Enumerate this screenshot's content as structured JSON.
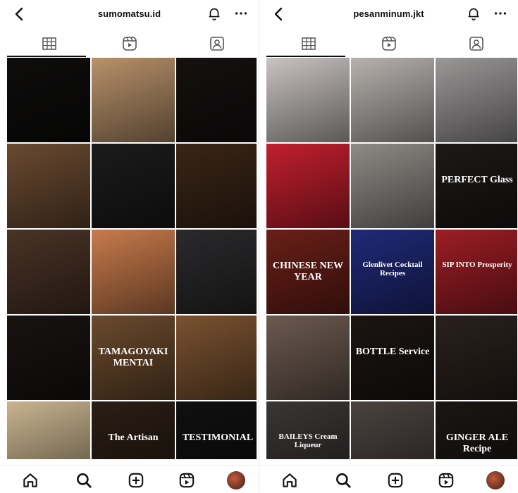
{
  "left": {
    "username": "sumomatsu.id",
    "tiles": [
      {
        "bg": "#0e0d0c"
      },
      {
        "bg": "#b8916a"
      },
      {
        "bg": "#141110"
      },
      {
        "bg": "#6a4a31"
      },
      {
        "bg": "#1b1b1b"
      },
      {
        "bg": "#3a2516"
      },
      {
        "bg": "#4a3326"
      },
      {
        "bg": "#c87b4c"
      },
      {
        "bg": "#2a2a2c"
      },
      {
        "bg": "#171311"
      },
      {
        "bg": "#6b4a2d",
        "caption": "TAMAGOYAKI MENTAI"
      },
      {
        "bg": "#7a5230"
      },
      {
        "bg": "#c9b48f"
      },
      {
        "bg": "#2b1e15",
        "caption": "The Artisan"
      },
      {
        "bg": "#101010",
        "caption": "TESTIMONIAL"
      }
    ]
  },
  "right": {
    "username": "pesanminum.jkt",
    "tiles": [
      {
        "bg": "#c9c3c2"
      },
      {
        "bg": "#b7b2ae"
      },
      {
        "bg": "#9a9797"
      },
      {
        "bg": "#c21f2e"
      },
      {
        "bg": "#8e8b86"
      },
      {
        "bg": "#1c1917",
        "caption": "PERFECT Glass"
      },
      {
        "bg": "#6a1f18",
        "caption": "CHINESE NEW YEAR"
      },
      {
        "bg": "#1f2a78",
        "caption": "Glenlivet Cocktail Recipes"
      },
      {
        "bg": "#9d1d25",
        "caption": "SIP INTO Prosperity"
      },
      {
        "bg": "#6c5a50"
      },
      {
        "bg": "#1b1512",
        "caption": "BOTTLE Service"
      },
      {
        "bg": "#2a211d"
      },
      {
        "bg": "#3a3634",
        "caption": "BAILEYS Cream Liqueur"
      },
      {
        "bg": "#4a4340"
      },
      {
        "bg": "#1a1614",
        "caption": "GINGER ALE Recipe"
      }
    ]
  }
}
